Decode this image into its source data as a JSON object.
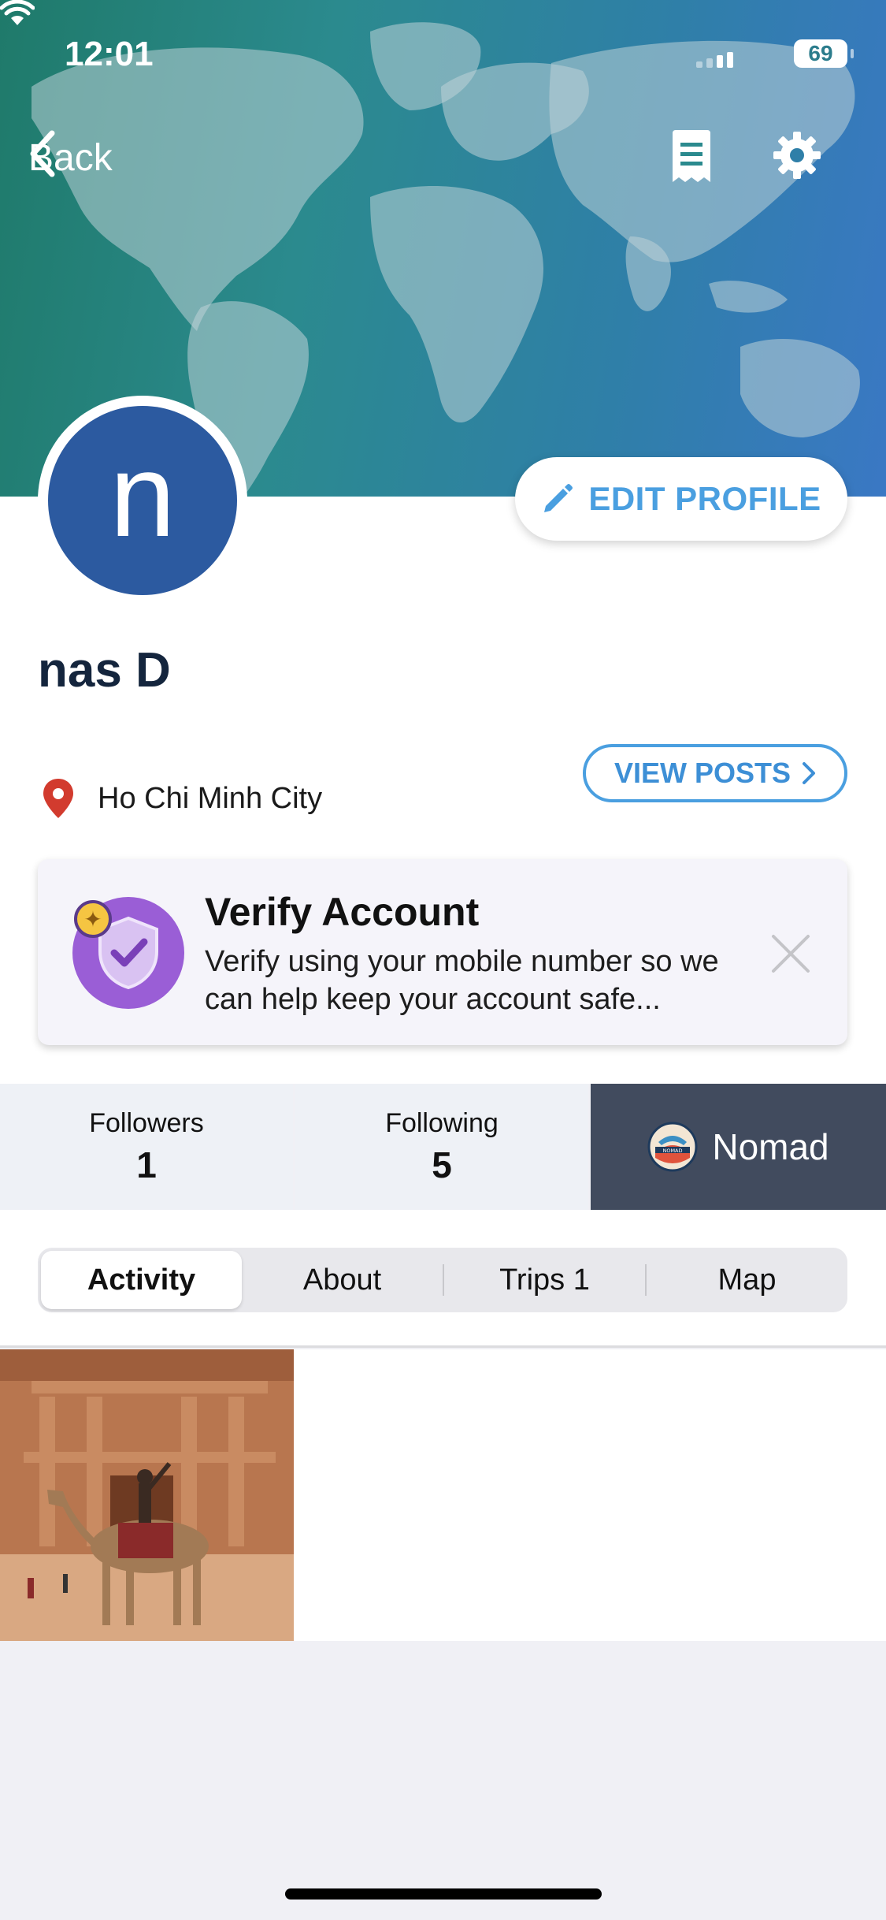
{
  "status_bar": {
    "time": "12:01",
    "battery": "69"
  },
  "nav": {
    "back_label": "Back"
  },
  "profile": {
    "avatar_initial": "n",
    "edit_label": "EDIT PROFILE",
    "name": "nas D",
    "location": "Ho Chi Minh City",
    "view_posts_label": "VIEW POSTS"
  },
  "verify_card": {
    "title": "Verify Account",
    "text": "Verify using your mobile number so we can help keep your account safe..."
  },
  "stats": {
    "followers_label": "Followers",
    "followers_value": "1",
    "following_label": "Following",
    "following_value": "5",
    "badge_label": "Nomad",
    "badge_emblem_text": "NOMAD"
  },
  "tabs": [
    {
      "label": "Activity"
    },
    {
      "label": "About"
    },
    {
      "label": "Trips 1"
    },
    {
      "label": "Map"
    }
  ],
  "colors": {
    "accent": "#4a9fe0",
    "avatar": "#2c5aa0",
    "verify_purple": "#9a5ed6",
    "nomad_bg": "#414b5e",
    "location_pin": "#d23b2e"
  }
}
